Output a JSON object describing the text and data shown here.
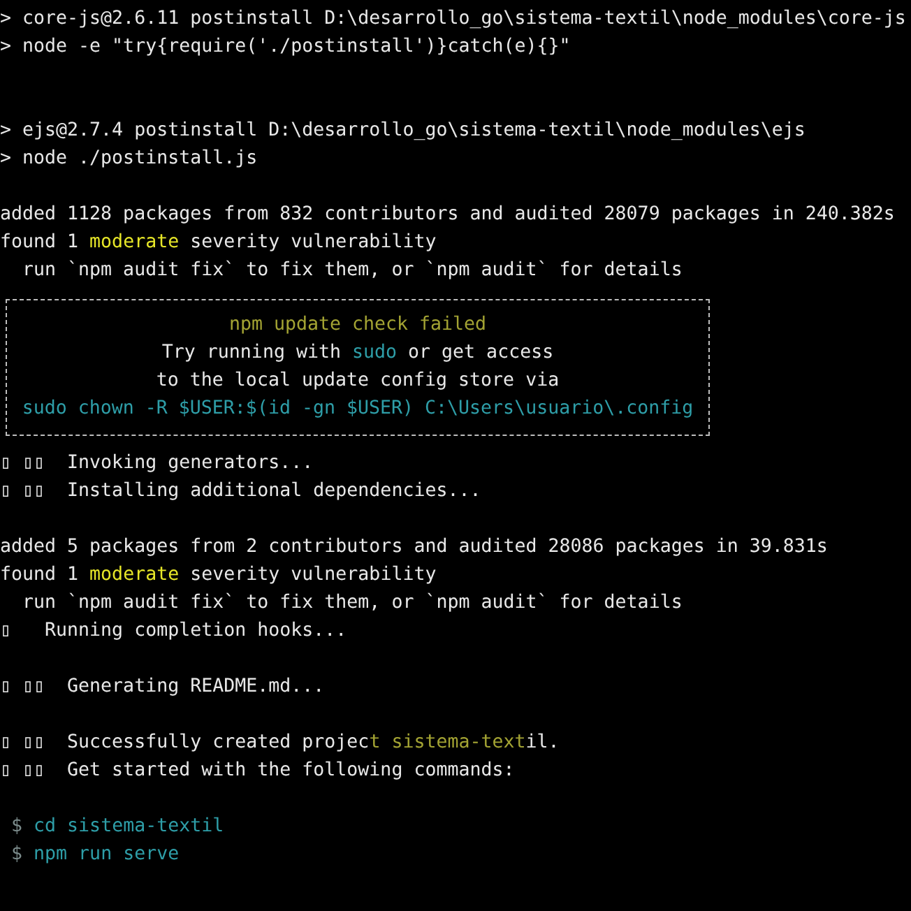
{
  "terminal": {
    "blocks": [
      {
        "kind": "script",
        "lines": [
          [
            {
              "text": "> core-js@2.6.11 postinstall D:\\desarrollo_go\\sistema-textil\\node_modules\\core-js",
              "kind": "plain"
            }
          ],
          [
            {
              "text": "> node -e \"try{require('./postinstall')}catch(e){}\"",
              "kind": "plain"
            }
          ]
        ]
      },
      {
        "kind": "script",
        "lines": [
          [
            {
              "text": "> ejs@2.7.4 postinstall D:\\desarrollo_go\\sistema-textil\\node_modules\\ejs",
              "kind": "plain"
            }
          ],
          [
            {
              "text": "> node ./postinstall.js",
              "kind": "plain"
            }
          ]
        ]
      },
      {
        "kind": "text",
        "lines": [
          [
            {
              "text": "added 1128 packages from 832 contributors and audited 28079 packages in 240.382s",
              "kind": "plain"
            }
          ],
          [
            {
              "text": "found 1 ",
              "kind": "plain"
            },
            {
              "text": "moderate",
              "kind": "warn"
            },
            {
              "text": " severity vulnerability",
              "kind": "plain"
            }
          ],
          [
            {
              "text": "  run `npm audit fix` to fix them, or `npm audit` for details",
              "kind": "plain"
            }
          ]
        ]
      },
      {
        "kind": "box",
        "lines": [
          [
            {
              "text": "npm update check failed",
              "kind": "olive"
            }
          ],
          [
            {
              "text": "Try running with ",
              "kind": "plain"
            },
            {
              "text": "sudo",
              "kind": "cmd"
            },
            {
              "text": " or get access",
              "kind": "plain"
            }
          ],
          [
            {
              "text": "to the local update config store via",
              "kind": "plain"
            }
          ],
          [
            {
              "text": "sudo chown -R $USER:$(id -gn $USER) C:\\Users\\usuario\\.config",
              "kind": "cmd"
            }
          ]
        ]
      },
      {
        "kind": "text",
        "lines": [
          [
            {
              "text": "▯ ▯▯  Invoking generators...",
              "kind": "plain"
            }
          ],
          [
            {
              "text": "▯ ▯▯  Installing additional dependencies...",
              "kind": "plain"
            }
          ]
        ]
      },
      {
        "kind": "text",
        "lines": [
          [
            {
              "text": "added 5 packages from 2 contributors and audited 28086 packages in 39.831s",
              "kind": "plain"
            }
          ],
          [
            {
              "text": "found 1 ",
              "kind": "plain"
            },
            {
              "text": "moderate",
              "kind": "warn"
            },
            {
              "text": " severity vulnerability",
              "kind": "plain"
            }
          ],
          [
            {
              "text": "  run `npm audit fix` to fix them, or `npm audit` for details",
              "kind": "plain"
            }
          ],
          [
            {
              "text": "▯   Running completion hooks...",
              "kind": "plain"
            }
          ]
        ]
      },
      {
        "kind": "text",
        "lines": [
          [
            {
              "text": "▯ ▯▯  Generating README.md...",
              "kind": "plain"
            }
          ]
        ]
      },
      {
        "kind": "text",
        "lines": [
          [
            {
              "text": "▯ ▯▯  Successfully created projec",
              "kind": "plain"
            },
            {
              "text": "t sistema-text",
              "kind": "olive"
            },
            {
              "text": "il.",
              "kind": "plain"
            }
          ],
          [
            {
              "text": "▯ ▯▯  Get started with the following commands:",
              "kind": "plain"
            }
          ]
        ]
      },
      {
        "kind": "text",
        "lines": [
          [
            {
              "text": " $ ",
              "kind": "dim"
            },
            {
              "text": "cd sistema-textil",
              "kind": "cmd"
            }
          ],
          [
            {
              "text": " $ ",
              "kind": "dim"
            },
            {
              "text": "npm run serve",
              "kind": "cmd"
            }
          ]
        ]
      }
    ]
  }
}
